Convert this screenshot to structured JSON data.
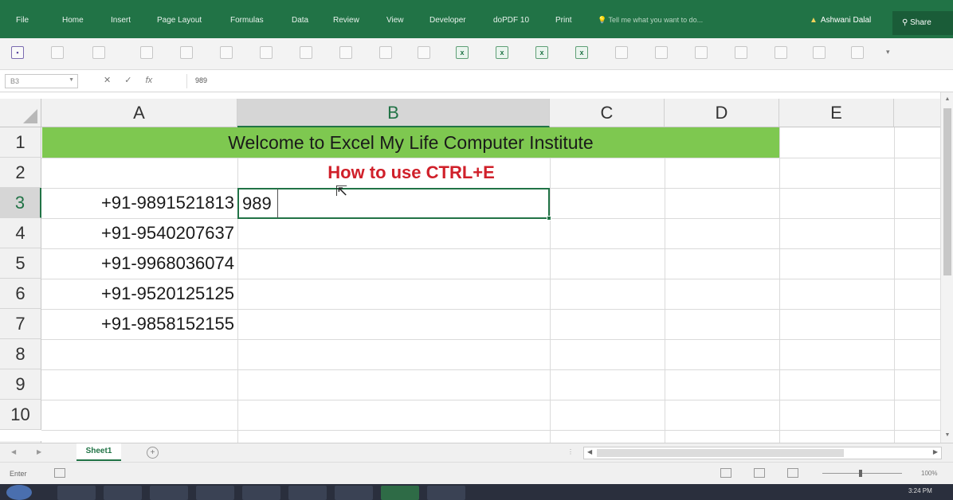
{
  "ribbon": {
    "tabs": [
      "File",
      "Home",
      "Insert",
      "Page Layout",
      "Formulas",
      "Data",
      "Review",
      "View",
      "Developer",
      "doPDF 10",
      "Print"
    ],
    "tell_me": "Tell me what you want to do...",
    "user": "Ashwani Dalal",
    "share": "Share",
    "accent": "#217346"
  },
  "formula_bar": {
    "name_box": "B3",
    "cancel": "✕",
    "enter": "✓",
    "fx": "fx",
    "content": "989"
  },
  "grid": {
    "columns": [
      "A",
      "B",
      "C",
      "D",
      "E"
    ],
    "selected_column": "B",
    "rows": [
      "1",
      "2",
      "3",
      "4",
      "5",
      "6",
      "7",
      "8",
      "9",
      "10"
    ],
    "selected_row": "3",
    "banner": "Welcome to Excel My Life Computer Institute",
    "subtitle": "How to use CTRL+E",
    "phones": [
      "+91-9891521813",
      "+91-9540207637",
      "+91-9968036074",
      "+91-9520125125",
      "+91-9858152155"
    ],
    "active_cell_value": "989",
    "banner_color": "#7ec850",
    "subtitle_color": "#d0202a"
  },
  "sheets": {
    "tabs": [
      "Sheet1"
    ],
    "add": "+"
  },
  "status": {
    "mode": "Enter",
    "zoom": "100%"
  },
  "taskbar": {
    "clock": "3:24 PM"
  }
}
